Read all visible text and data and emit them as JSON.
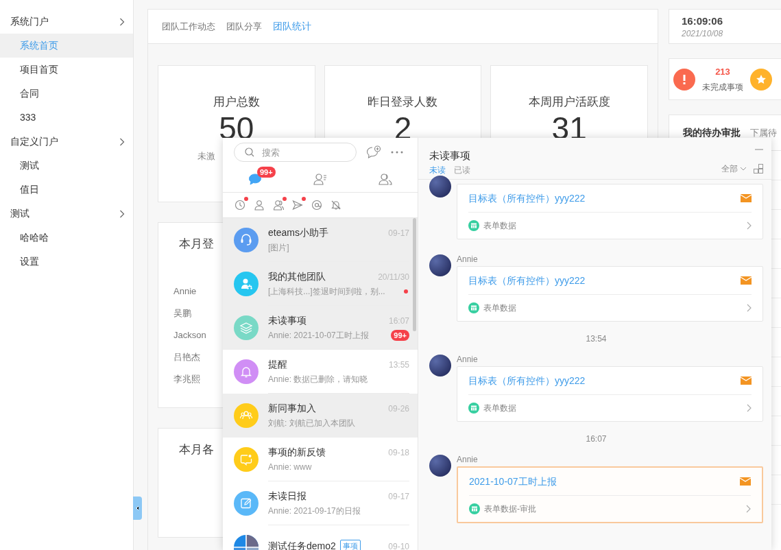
{
  "sidebar": {
    "items": [
      {
        "label": "系统门户",
        "kind": "group",
        "selected": false
      },
      {
        "label": "系统首页",
        "kind": "page",
        "selected": true
      },
      {
        "label": "项目首页",
        "kind": "page",
        "selected": false
      },
      {
        "label": "合同",
        "kind": "page",
        "selected": false
      },
      {
        "label": "333",
        "kind": "page",
        "selected": false
      },
      {
        "label": "自定义门户",
        "kind": "group",
        "selected": false
      },
      {
        "label": "测试",
        "kind": "page",
        "selected": false
      },
      {
        "label": "值日",
        "kind": "page",
        "selected": false
      },
      {
        "label": "测试",
        "kind": "group",
        "selected": false
      },
      {
        "label": "哈哈哈",
        "kind": "page",
        "selected": false
      },
      {
        "label": "设置",
        "kind": "page",
        "selected": false
      }
    ]
  },
  "tabs": [
    {
      "label": "团队工作动态",
      "selected": false
    },
    {
      "label": "团队分享",
      "selected": false
    },
    {
      "label": "团队统计",
      "selected": true
    }
  ],
  "stats": [
    {
      "title": "用户总数",
      "value": "50",
      "note": "未激"
    },
    {
      "title": "昨日登录人数",
      "value": "2"
    },
    {
      "title": "本周用户活跃度",
      "value": "31"
    }
  ],
  "login_card": {
    "title": "本月登",
    "names": [
      "Annie",
      "吴鹏",
      "Jackson",
      "吕艳杰",
      "李兆熙"
    ]
  },
  "module_card": {
    "title": "本月各"
  },
  "clock": {
    "time": "16:09:06",
    "date": "2021/10/08"
  },
  "summary": {
    "count": "213",
    "label": "未完成事项"
  },
  "approvals": {
    "tabs": [
      {
        "label": "我的待办审批",
        "selected": true
      },
      {
        "label": "下属待",
        "selected": false
      }
    ]
  },
  "chat": {
    "search": {
      "placeholder": "搜索"
    },
    "nav_tabs": [
      {
        "kind": "messages",
        "selected": true,
        "badge": "99+"
      },
      {
        "kind": "contacts",
        "selected": false
      },
      {
        "kind": "groups",
        "selected": false
      }
    ],
    "filters": [
      {
        "kind": "clock",
        "dot": true
      },
      {
        "kind": "person",
        "dot": false
      },
      {
        "kind": "group",
        "dot": true
      },
      {
        "kind": "send",
        "dot": true
      },
      {
        "kind": "at",
        "dot": false
      },
      {
        "kind": "mute",
        "dot": false
      }
    ],
    "conversations": [
      {
        "kind": "headset",
        "color": "#5b9cf0",
        "title": "eteams小助手",
        "time": "09-17",
        "preview": "[图片]",
        "pinned": true
      },
      {
        "kind": "team",
        "color": "#26c6f0",
        "title": "我的其他团队",
        "time": "20/11/30",
        "preview": "[上海科技...]签退时间到啦，别...",
        "pinned": true,
        "dot": true
      },
      {
        "kind": "layers",
        "color": "#79d9c6",
        "title": "未读事项",
        "time": "16:07",
        "preview": "Annie: 2021-10-07工时上报",
        "pinned": true,
        "badge": "99+"
      },
      {
        "kind": "bell",
        "color": "#d08ef5",
        "title": "提醒",
        "time": "13:55",
        "preview": "Annie: 数据已删除，请知晓",
        "pinned": false
      },
      {
        "kind": "people",
        "color": "#ffcc1a",
        "title": "新同事加入",
        "time": "09-26",
        "preview": "刘航: 刘航已加入本团队",
        "pinned": true
      },
      {
        "kind": "feedback",
        "color": "#ffcc1a",
        "title": "事项的新反馈",
        "time": "09-18",
        "preview": "Annie: www",
        "pinned": false
      },
      {
        "kind": "edit",
        "color": "#5ab8f8",
        "title": "未读日报",
        "time": "09-17",
        "preview": "Annie: 2021-09-17的日报",
        "pinned": false
      },
      {
        "kind": "collage",
        "color": "#1e88e5",
        "title": "测试任务demo2",
        "tag": "事项",
        "time": "09-10",
        "pinned": false
      }
    ],
    "detail": {
      "title": "未读事项",
      "tabs": [
        {
          "label": "未读",
          "selected": true
        },
        {
          "label": "已读",
          "selected": false
        }
      ],
      "filter": "全部",
      "messages": [
        {
          "kind": "message",
          "title": "目标表（所有控件）yyy222",
          "subtitle": "表单数据",
          "highlighted": false
        },
        {
          "kind": "message",
          "sender": "Annie",
          "title": "目标表（所有控件）yyy222",
          "subtitle": "表单数据",
          "highlighted": false
        },
        {
          "kind": "time",
          "text": "13:54"
        },
        {
          "kind": "message",
          "sender": "Annie",
          "title": "目标表（所有控件）yyy222",
          "subtitle": "表单数据",
          "highlighted": false
        },
        {
          "kind": "time",
          "text": "16:07"
        },
        {
          "kind": "message",
          "sender": "Annie",
          "title": "2021-10-07工时上报",
          "subtitle": "表单数据-审批",
          "highlighted": true
        }
      ]
    }
  }
}
